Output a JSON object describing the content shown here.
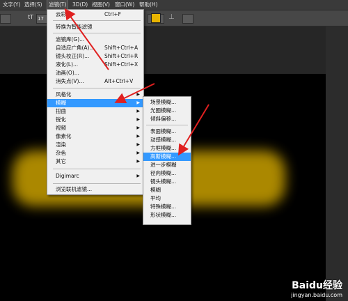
{
  "menubar": {
    "items": [
      "文字(Y)",
      "选择(S)",
      "滤镜(T)",
      "3D(D)",
      "视图(V)",
      "窗口(W)",
      "帮助(H)"
    ]
  },
  "optbar": {
    "text_icon": "tT",
    "size_value": "17"
  },
  "filter_menu": {
    "items": [
      {
        "label": "云彩",
        "shortcut": "Ctrl+F"
      },
      {
        "label": "转换为智能滤镜",
        "shortcut": ""
      },
      {
        "label": "滤镜库(G)...",
        "shortcut": ""
      },
      {
        "label": "自适应广角(A)...",
        "shortcut": "Shift+Ctrl+A"
      },
      {
        "label": "镜头校正(R)...",
        "shortcut": "Shift+Ctrl+R"
      },
      {
        "label": "液化(L)...",
        "shortcut": "Shift+Ctrl+X"
      },
      {
        "label": "油画(O)...",
        "shortcut": ""
      },
      {
        "label": "消失点(V)...",
        "shortcut": "Alt+Ctrl+V"
      },
      {
        "label": "风格化",
        "shortcut": ""
      },
      {
        "label": "模糊",
        "shortcut": ""
      },
      {
        "label": "扭曲",
        "shortcut": ""
      },
      {
        "label": "锐化",
        "shortcut": ""
      },
      {
        "label": "视频",
        "shortcut": ""
      },
      {
        "label": "像素化",
        "shortcut": ""
      },
      {
        "label": "渲染",
        "shortcut": ""
      },
      {
        "label": "杂色",
        "shortcut": ""
      },
      {
        "label": "其它",
        "shortcut": ""
      },
      {
        "label": "Digimarc",
        "shortcut": ""
      },
      {
        "label": "浏览联机滤镜...",
        "shortcut": ""
      }
    ]
  },
  "blur_submenu": {
    "items": [
      "场景模糊...",
      "光圈模糊...",
      "倾斜偏移...",
      "表面模糊...",
      "动感模糊...",
      "方框模糊...",
      "高斯模糊...",
      "进一步模糊",
      "径向模糊...",
      "镜头模糊...",
      "模糊",
      "平均",
      "特殊模糊...",
      "形状模糊..."
    ]
  },
  "watermark": {
    "brand": "Baidu经验",
    "url": "jingyan.baidu.com"
  },
  "colors": {
    "highlight": "#3399ff",
    "arrow": "#e02020",
    "swatch": "#e8b400"
  }
}
